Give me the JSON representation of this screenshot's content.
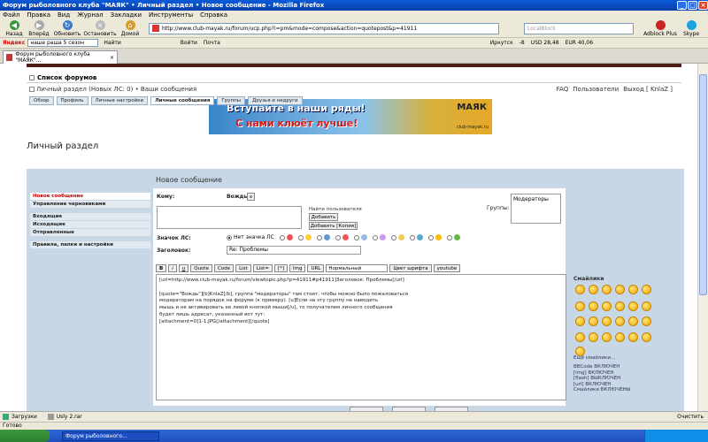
{
  "window": {
    "title": "Форум рыболовного клуба \"МАЯК\" • Личный раздел • Новое сообщение - Mozilla Firefox"
  },
  "menu": [
    "Файл",
    "Правка",
    "Вид",
    "Журнал",
    "Закладки",
    "Инструменты",
    "Справка"
  ],
  "nav": {
    "back": "Назад",
    "forward": "Вперёд",
    "reload": "Обновить",
    "stop": "Остановить",
    "home": "Домой",
    "url": "http://www.club-mayak.ru/forum/ucp.php?i=pm&mode=compose&action=quotepost&p=41911",
    "search_placeholder": "LocalBlock",
    "adblock": "Adblock Plus",
    "skype": "Skype"
  },
  "yandex": {
    "logo": "Яндекс",
    "query": "наше раша 5 сезон",
    "find": "Найти",
    "weather": "Войти",
    "mail": "Почта",
    "city": "Иркутск",
    "temp": "-8",
    "usd": "USD 28,48",
    "eur": "EUR 40,06"
  },
  "tab": {
    "label": "Форум рыболовного клуба \"МАЯК\"..."
  },
  "forum": {
    "forum_list": "Список форумов",
    "breadcrumb": "Личный раздел (Новых ЛС: 0) • Ваши сообщения",
    "faq": "FAQ",
    "users": "Пользователи",
    "logout": "Выход [ KnlaZ ]",
    "banner_line1": "Вступайте в наши ряды!",
    "banner_line2": "С нами клюёт лучше!",
    "banner_logo": "МАЯК",
    "banner_site": "club-mayak.ru",
    "page_title": "Личный раздел"
  },
  "ucp_tabs": [
    "Обзор",
    "Профиль",
    "Личные настройки",
    "Личные сообщения",
    "Группы",
    "Друзья и недруги"
  ],
  "side_menu": [
    "Новое сообщение",
    "Управление черновиками",
    "Входящие",
    "Исходящие",
    "Отправленные",
    "Правила, папки и настройки"
  ],
  "form": {
    "section_title": "Новое сообщение",
    "to_label": "Кому:",
    "to_value": "Вождь",
    "to_remove": "x",
    "find_user": "Найти пользователя",
    "add_btn": "Добавить",
    "add_copy_btn": "Добавить [Копия]",
    "groups_label": "Группы:",
    "groups_value": "Модераторы",
    "icon_label": "Значок ЛС:",
    "no_icon": "Нет значка ЛС",
    "subject_label": "Заголовок:",
    "subject_value": "Re: Проблемы"
  },
  "bbcode_buttons": [
    "B",
    "i",
    "u",
    "Quote",
    "Code",
    "List",
    "List=",
    "[*]",
    "Img",
    "URL"
  ],
  "font_size": "Нормальный",
  "font_color": "Цвет шрифта",
  "youtube": "youtube",
  "editor_text": "[url=http://www.club-mayak.ru/forum/viewtopic.php?p=41911#p41911]Заголовок: Проблемы[/url]\n\n[quote=\"Вождь\"][b]KnlaZ[/b], группа \"модераторы\" там стоит, чтобы можно было пожаловаться\nмодераторам на порядок на форуме (к примеру). [u]Если на эту группу не наводить\nмышь и не активировать ее левой кнопкой мыши[/u], то получателем личного сообщения\nбудет лишь адресат, указанный вот тут:\n[attachment=0]1-1.JPG[/attachment][/quote]",
  "smilies": {
    "title": "Смайлики",
    "more": "Ещё смайлики...",
    "info": [
      "BBCode ВКЛЮЧЕН",
      "[img] ВКЛЮЧЕН",
      "[flash] ВЫКЛЮЧЕН",
      "[url] ВКЛЮЧЕН",
      "Смайлики ВКЛЮЧЕНЫ"
    ]
  },
  "downloads": {
    "label": "Загрузки",
    "file": "Usly 2.rar",
    "clear": "Очистить"
  },
  "status": "Готово",
  "taskbar": {
    "item": "Форум рыболовного...",
    "clock": ""
  },
  "colors": {
    "accent": "#c8d7e6",
    "title_bar": "#0a5bd8",
    "active_menu": "#cc0000"
  }
}
